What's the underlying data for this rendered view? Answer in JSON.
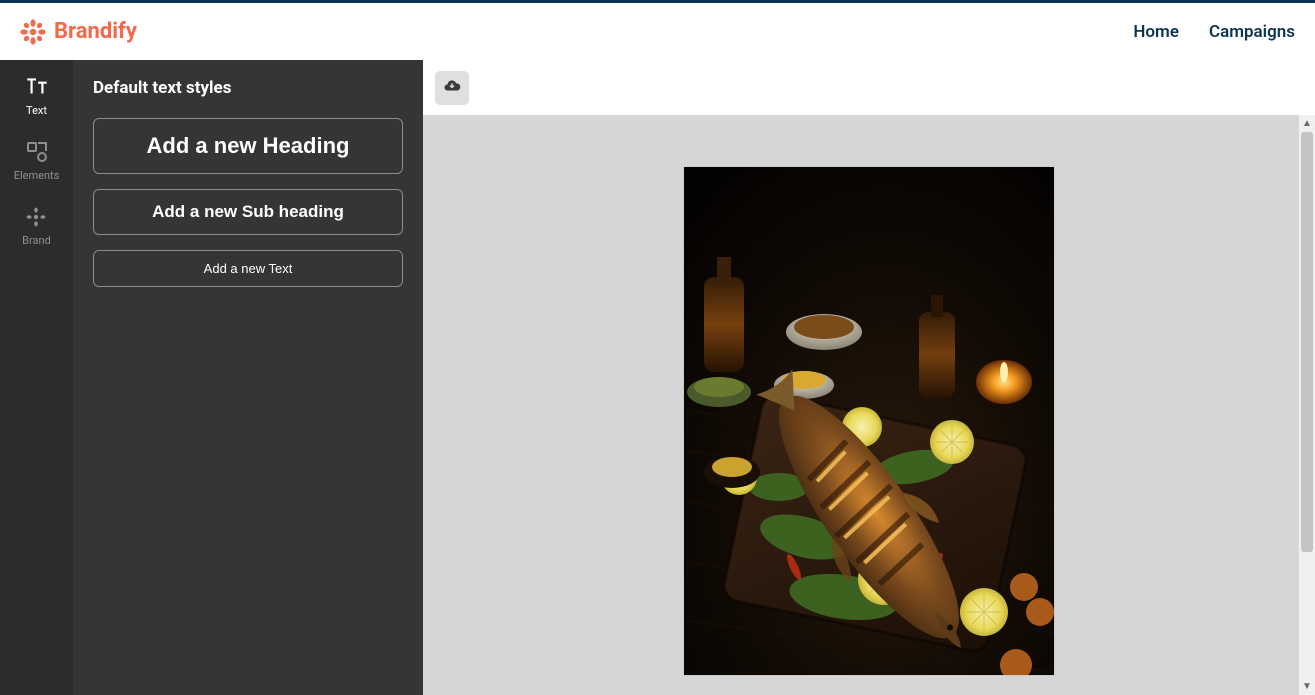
{
  "brand": {
    "name": "Brandify"
  },
  "nav": {
    "home": "Home",
    "campaigns": "Campaigns"
  },
  "rail": {
    "text": "Text",
    "elements": "Elements",
    "brand": "Brand"
  },
  "panel": {
    "title": "Default text styles",
    "heading_btn": "Add a new Heading",
    "subheading_btn": "Add a new Sub heading",
    "text_btn": "Add a new Text"
  },
  "canvas": {
    "image_description": "Grilled whole fish on wooden board with lemon slices, herbs, spice bowls, bottles and candle on dark wood table"
  }
}
